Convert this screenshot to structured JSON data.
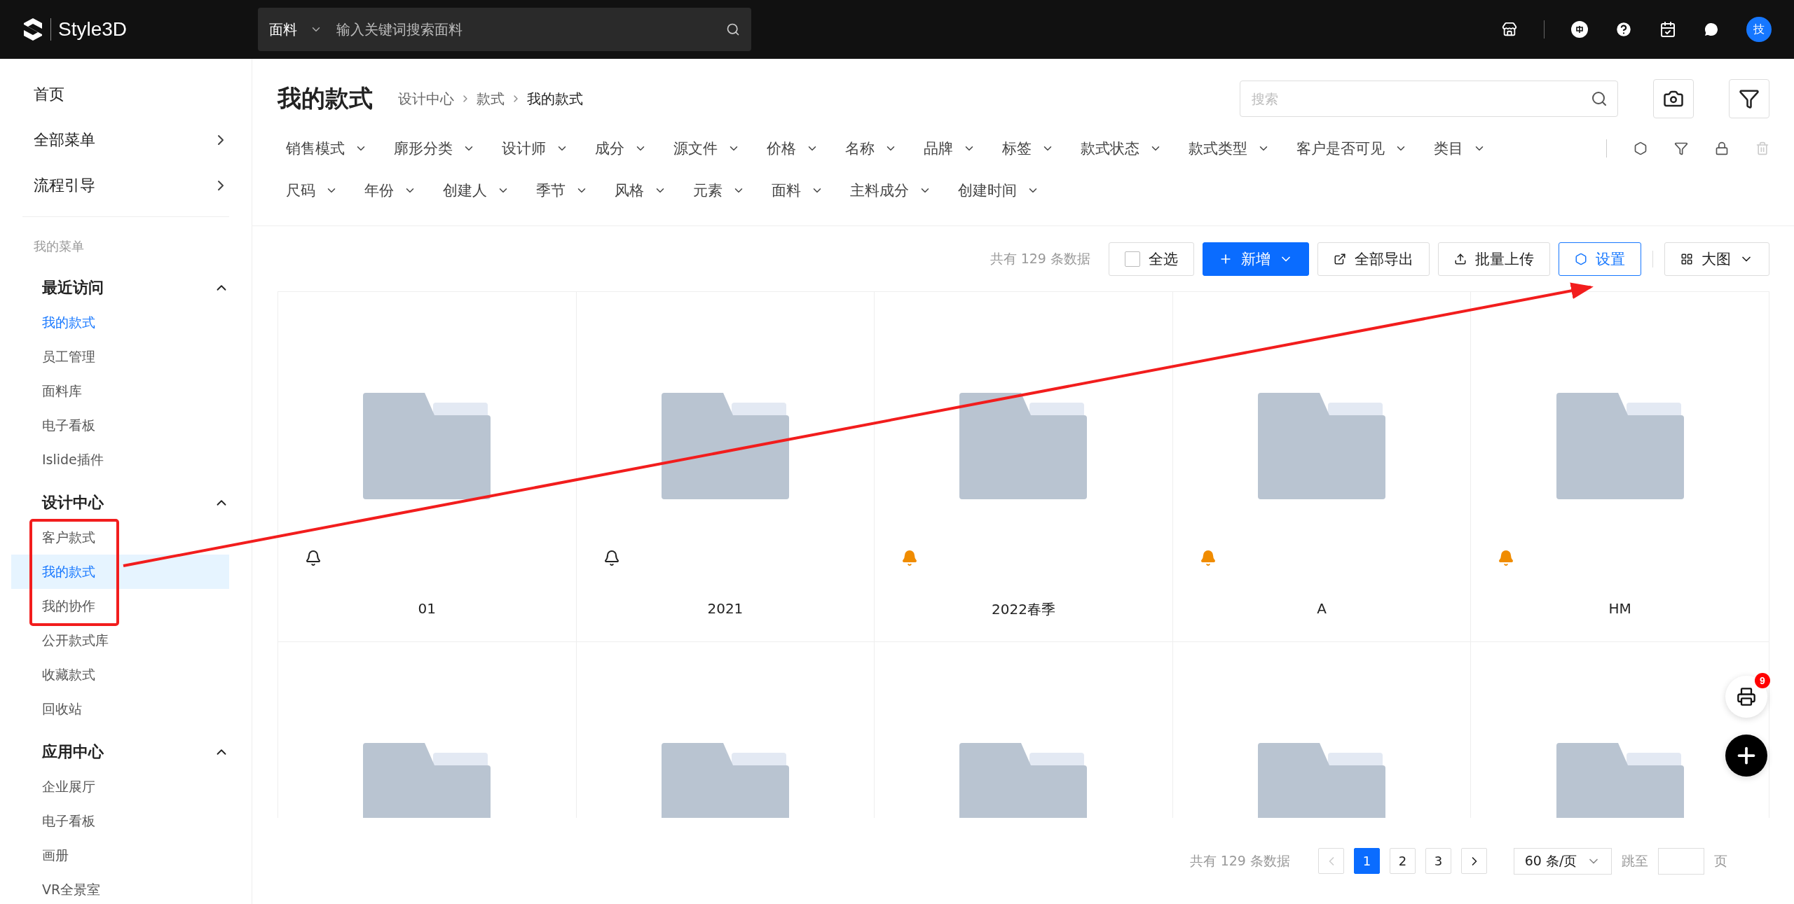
{
  "topbar": {
    "logo_text": "Style3D",
    "search": {
      "category": "面料",
      "placeholder": "输入关键词搜索面料"
    },
    "avatar_text": "技"
  },
  "sidebar": {
    "top_items": [
      {
        "label": "首页",
        "has_arrow": false
      },
      {
        "label": "全部菜单",
        "has_arrow": true
      },
      {
        "label": "流程引导",
        "has_arrow": true
      }
    ],
    "section_label": "我的菜单",
    "groups": [
      {
        "title": "最近访问",
        "expanded": true,
        "items": [
          {
            "label": "我的款式",
            "selected": true,
            "highlighted": false
          },
          {
            "label": "员工管理",
            "selected": false,
            "highlighted": false
          },
          {
            "label": "面料库",
            "selected": false,
            "highlighted": false
          },
          {
            "label": "电子看板",
            "selected": false,
            "highlighted": false
          },
          {
            "label": "Islide插件",
            "selected": false,
            "highlighted": false
          }
        ]
      },
      {
        "title": "设计中心",
        "expanded": true,
        "items": [
          {
            "label": "客户款式",
            "selected": false,
            "highlighted": false
          },
          {
            "label": "我的款式",
            "selected": true,
            "highlighted": true
          },
          {
            "label": "我的协作",
            "selected": false,
            "highlighted": false
          },
          {
            "label": "公开款式库",
            "selected": false,
            "highlighted": false
          },
          {
            "label": "收藏款式",
            "selected": false,
            "highlighted": false
          },
          {
            "label": "回收站",
            "selected": false,
            "highlighted": false
          }
        ]
      },
      {
        "title": "应用中心",
        "expanded": true,
        "items": [
          {
            "label": "企业展厅",
            "selected": false,
            "highlighted": false
          },
          {
            "label": "电子看板",
            "selected": false,
            "highlighted": false
          },
          {
            "label": "画册",
            "selected": false,
            "highlighted": false
          },
          {
            "label": "VR全景室",
            "selected": false,
            "highlighted": false
          }
        ]
      }
    ]
  },
  "header": {
    "title": "我的款式",
    "breadcrumb": [
      "设计中心",
      "款式",
      "我的款式"
    ],
    "search_placeholder": "搜索"
  },
  "filters": [
    [
      "销售模式",
      "廓形分类",
      "设计师",
      "成分",
      "源文件",
      "价格",
      "名称",
      "品牌",
      "标签",
      "款式状态",
      "款式类型",
      "客户是否可见",
      "类目"
    ],
    [
      "尺码",
      "年份",
      "创建人",
      "季节",
      "风格",
      "元素",
      "面料",
      "主料成分",
      "创建时间"
    ]
  ],
  "toolbar": {
    "count": "共有 129 条数据",
    "select_all": {
      "label": "全选",
      "checked": false
    },
    "new_label": "新增",
    "export_label": "全部导出",
    "upload_label": "批量上传",
    "settings_label": "设置",
    "view_label": "大图"
  },
  "folders": [
    {
      "kind": "named",
      "name": "01",
      "alert": false
    },
    {
      "kind": "named",
      "name": "2021",
      "alert": false
    },
    {
      "kind": "named",
      "name": "2022春季",
      "alert": true
    },
    {
      "kind": "named",
      "name": "A",
      "alert": true
    },
    {
      "kind": "named",
      "name": "HM",
      "alert": true
    },
    {
      "kind": "partial"
    },
    {
      "kind": "partial"
    },
    {
      "kind": "partial"
    },
    {
      "kind": "partial"
    },
    {
      "kind": "partial"
    }
  ],
  "pagination": {
    "total": "共有 129 条数据",
    "pages": [
      {
        "label": "1",
        "selected": true
      },
      {
        "label": "2",
        "selected": false
      },
      {
        "label": "3",
        "selected": false
      }
    ],
    "page_size": "60 条/页",
    "jump_label": "跳至",
    "page_suffix": "页"
  },
  "fab": {
    "badge": "9"
  },
  "annotation": {
    "frame": true,
    "arrow": true
  }
}
